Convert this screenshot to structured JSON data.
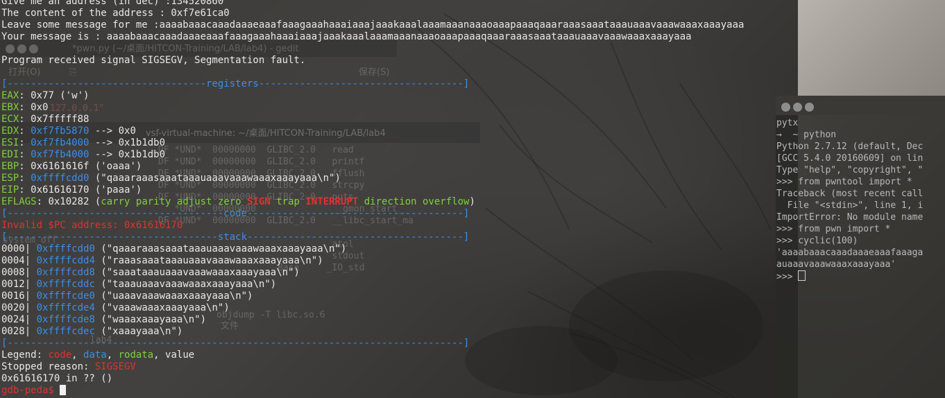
{
  "background": {
    "gedit": {
      "title": "*pwn.py (~/桌面/HITCON-Training/LAB/lab4) - gedit",
      "open_label": "打开(O)",
      "save_label": "保存(S)",
      "code_fragment": "127.0.0.1\""
    },
    "vsf_terminal": {
      "title": "vsf-virtual-machine: ~/桌面/HITCON-Training/LAB/lab4",
      "rows": [
        "DF *UND*  00000000  GLIBC_2.0   read",
        "DF *UND*  00000000  GLIBC_2.0   printf",
        "DF *UND*  00000000  GLIBC_2.0   fflush",
        "DF *UND*  00000000  GLIBC_2.0   strcpy",
        "DF *UND*  00000000  GLIBC_2.0   puts",
        "   *UND*  00000000              __gmon_start__",
        "DF *UND*  00000000  GLIBC_2.0   __libc_start_ma",
        "                                atol",
        "                                stdout",
        "                      Base     _IO_std"
      ],
      "objdump_cmd": "objdump -T libc.so.6",
      "file_label": "文件",
      "lab_path": "lab4",
      "system_off": "system_off"
    }
  },
  "main_terminal": {
    "lines": {
      "addr_prompt": "Give me an address (in dec) :134520860",
      "addr_content": "The content of the address : 0xf7e61ca0",
      "leave_msg": "Leave some message for me :aaaabaaacaaadaaaeaaafaaagaaahaaaiaaajaaakaaalaaamaaanaaaoaaapaaaqaaaraaasaaataaauaaavaaawaaaxaaayaaa",
      "your_msg": "Your message is : aaaabaaacaaadaaaeaaafaaagaaahaaaiaaajaaakaaalaaamaaanaaaoaaapaaaqaaaraaasaaataaauaaavaaawaaaxaaayaaa",
      "signal": "Program received signal SIGSEGV, Segmentation fault."
    },
    "registers_header": "[----------------------------------registers-----------------------------------]",
    "registers": [
      {
        "name": "EAX",
        "value": "0x77 ('w')"
      },
      {
        "name": "EBX",
        "value": "0x0"
      },
      {
        "name": "ECX",
        "value": "0x7fffff88"
      },
      {
        "name": "EDX",
        "ptr": "0xf7fb5870",
        "value": "--> 0x0"
      },
      {
        "name": "ESI",
        "ptr": "0xf7fb4000",
        "value": "--> 0x1b1db0"
      },
      {
        "name": "EDI",
        "ptr": "0xf7fb4000",
        "value": "--> 0x1b1db0"
      },
      {
        "name": "EBP",
        "value": "0x6161616f ('oaaa')"
      },
      {
        "name": "ESP",
        "ptr": "0xffffcdd0",
        "value": "(\"qaaaraaasaaataaauaaavaaawaaaxaaayaaa\\n\")"
      },
      {
        "name": "EIP",
        "value": "0x61616170 ('paaa')"
      }
    ],
    "eflags": {
      "name": "EFLAGS",
      "value": "0x10282",
      "flags": [
        {
          "text": "carry",
          "active": false
        },
        {
          "text": "parity",
          "active": false
        },
        {
          "text": "adjust",
          "active": false
        },
        {
          "text": "zero",
          "active": false
        },
        {
          "text": "SIGN",
          "active": true
        },
        {
          "text": "trap",
          "active": false
        },
        {
          "text": "INTERRUPT",
          "active": true
        },
        {
          "text": "direction",
          "active": false
        },
        {
          "text": "overflow",
          "active": false
        }
      ]
    },
    "code_header": "[-------------------------------------code-------------------------------------]",
    "invalid_pc": "Invalid $PC address: 0x61616170",
    "stack_header": "[------------------------------------stack-------------------------------------]",
    "stack": [
      {
        "off": "0000|",
        "addr": "0xffffcdd0",
        "val": "(\"qaaaraaasaaataaauaaavaaawaaaxaaayaaa\\n\")"
      },
      {
        "off": "0004|",
        "addr": "0xffffcdd4",
        "val": "(\"raaasaaataaauaaavaaawaaaxaaayaaa\\n\")"
      },
      {
        "off": "0008|",
        "addr": "0xffffcdd8",
        "val": "(\"saaataaauaaavaaawaaaxaaayaaa\\n\")"
      },
      {
        "off": "0012|",
        "addr": "0xffffcddc",
        "val": "(\"taaauaaavaaawaaaxaaayaaa\\n\")"
      },
      {
        "off": "0016|",
        "addr": "0xffffcde0",
        "val": "(\"uaaavaaawaaaxaaayaaa\\n\")"
      },
      {
        "off": "0020|",
        "addr": "0xffffcde4",
        "val": "(\"vaaawaaaxaaayaaa\\n\")"
      },
      {
        "off": "0024|",
        "addr": "0xffffcde8",
        "val": "(\"waaaxaaayaaa\\n\")"
      },
      {
        "off": "0028|",
        "addr": "0xffffcdec",
        "val": "(\"xaaayaaa\\n\")"
      }
    ],
    "end_header": "[------------------------------------------------------------------------------]",
    "legend": {
      "prefix": "Legend: ",
      "code": "code",
      "data": "data",
      "rodata": "rodata",
      "value": "value",
      "sep": ", "
    },
    "stopped": {
      "prefix": "Stopped reason: ",
      "reason": "SIGSEGV"
    },
    "location": "0x61616170 in ?? ()",
    "prompt": "gdb-peda$ "
  },
  "right_terminal": {
    "lines": [
      "pytx",
      "→  ~ python",
      "Python 2.7.12 (default, Dec",
      "[GCC 5.4.0 20160609] on lin",
      "Type \"help\", \"copyright\", \"",
      ">>> from pwntool import *",
      "Traceback (most recent call",
      "  File \"<stdin>\", line 1, i",
      "ImportError: No module name",
      ">>> from pwn import *",
      ">>> cyclic(100)",
      "'aaaabaaacaaadaaaeaaafaaaga",
      "auaaavaaawaaaxaaayaaa'"
    ],
    "prompt": ">>> "
  },
  "colors": {
    "green": "#7fd13b",
    "red": "#e03232",
    "blue": "#3b8ee8",
    "header": "#5a6f8c"
  }
}
